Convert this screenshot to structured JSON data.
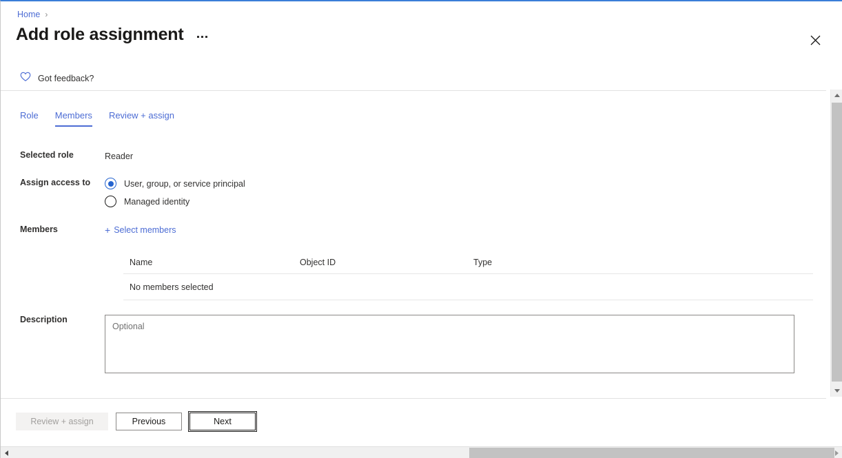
{
  "window": {
    "accent_color": "#3a7ed8",
    "link_color": "#4c6cd4"
  },
  "breadcrumb": {
    "home_label": "Home",
    "separator": "›"
  },
  "header": {
    "title": "Add role assignment",
    "more_menu_name": "more-options",
    "close_label": "Close",
    "feedback_label": "Got feedback?"
  },
  "tabs": [
    {
      "label": "Role",
      "active": false
    },
    {
      "label": "Members",
      "active": true
    },
    {
      "label": "Review + assign",
      "active": false
    }
  ],
  "form": {
    "selected_role": {
      "label": "Selected role",
      "value": "Reader"
    },
    "assign_access_to": {
      "label": "Assign access to",
      "options": [
        {
          "label": "User, group, or service principal",
          "checked": true
        },
        {
          "label": "Managed identity",
          "checked": false
        }
      ]
    },
    "members": {
      "label": "Members",
      "select_members_link": "Select members",
      "plus_glyph": "+"
    },
    "description": {
      "label": "Description",
      "value": "",
      "placeholder": "Optional"
    }
  },
  "members_table": {
    "columns": [
      "Name",
      "Object ID",
      "Type"
    ],
    "empty_message": "No members selected",
    "rows": []
  },
  "footer": {
    "review_assign_label": "Review + assign",
    "review_assign_disabled": true,
    "previous_label": "Previous",
    "next_label": "Next",
    "next_focused": true
  }
}
